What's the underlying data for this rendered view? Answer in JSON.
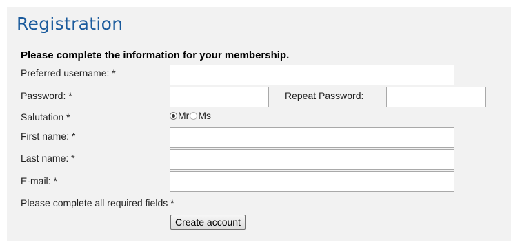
{
  "title": "Registration",
  "intro": "Please complete the information for your membership.",
  "fields": {
    "username": {
      "label": "Preferred username: *",
      "value": ""
    },
    "password": {
      "label": "Password: *",
      "value": ""
    },
    "repeat_password": {
      "label": "Repeat Password:",
      "value": ""
    },
    "first_name": {
      "label": "First name: *",
      "value": ""
    },
    "last_name": {
      "label": "Last name: *",
      "value": ""
    },
    "email": {
      "label": "E-mail: *",
      "value": ""
    }
  },
  "salutation": {
    "label": "Salutation *",
    "options": [
      {
        "label": "Mr",
        "selected": true
      },
      {
        "label": "Ms",
        "selected": false
      }
    ]
  },
  "required_note": "Please complete all required fields *",
  "submit_label": "Create account",
  "colors": {
    "title": "#1a5a9c",
    "panel_background": "#f2f2f2"
  }
}
